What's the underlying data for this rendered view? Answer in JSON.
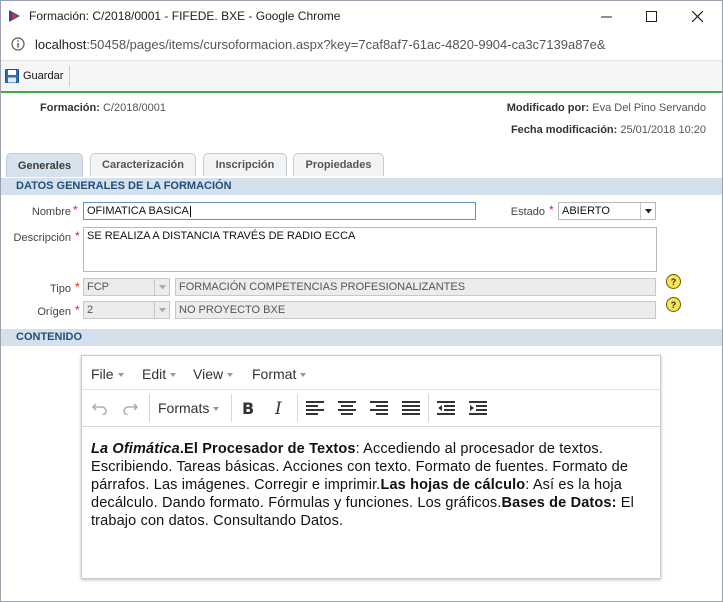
{
  "window": {
    "title": "Formación: C/2018/0001 - FIFEDE. BXE - Google Chrome",
    "url_host": "localhost",
    "url_rest": ":50458/pages/items/cursoformacion.aspx?key=7caf8af7-61ac-4820-9904-ca3c7139a87e&"
  },
  "toolbar": {
    "save_label": "Guardar"
  },
  "header": {
    "formacion_label": "Formación:",
    "formacion_value": "C/2018/0001",
    "modificado_label": "Modificado por:",
    "modificado_value": "Eva Del Pino Servando",
    "fecha_label": "Fecha modificación:",
    "fecha_value": "25/01/2018 10:20"
  },
  "tabs": [
    "Generales",
    "Caracterización",
    "Inscripción",
    "Propiedades"
  ],
  "sections": {
    "general": "DATOS GENERALES DE LA FORMACIÓN",
    "contenido": "CONTENIDO"
  },
  "form": {
    "nombre_label": "Nombre",
    "nombre_value": "OFIMATICA BASICA",
    "estado_label": "Estado",
    "estado_value": "ABIERTO",
    "descripcion_label": "Descripción",
    "descripcion_value": "SE REALIZA A DISTANCIA TRAVÉS DE RADIO ECCA",
    "tipo_label": "Tipo",
    "tipo_code": "FCP",
    "tipo_desc": "FORMACIÓN COMPETENCIAS PROFESIONALIZANTES",
    "origen_label": "Orígen",
    "origen_code": "2",
    "origen_desc": "NO PROYECTO BXE",
    "help_glyph": "?"
  },
  "editor": {
    "menus": [
      "File",
      "Edit",
      "View",
      "Format"
    ],
    "formats_label": "Formats",
    "content": {
      "p1_em": "La Ofimática",
      "p2_bold": ".El Procesador de Textos",
      "p3": ": Accediendo al procesador de textos. Escribiendo. Tareas básicas. Acciones con texto. Formato de fuentes. Formato de párrafos. Las imágenes. Corregir e imprimir.",
      "p4_bold": "Las hojas de cálculo",
      "p5": ": Así es la hoja decálculo. Dando formato. Fórmulas y funciones. Los gráficos.",
      "p6_bold": "Bases de Datos:",
      "p7": " El trabajo con datos. Consultando Datos."
    }
  },
  "colors": {
    "accent_green": "#3cb043",
    "section_bg": "#d4e1ed",
    "section_text": "#1f4e79",
    "required": "#dd2211"
  }
}
